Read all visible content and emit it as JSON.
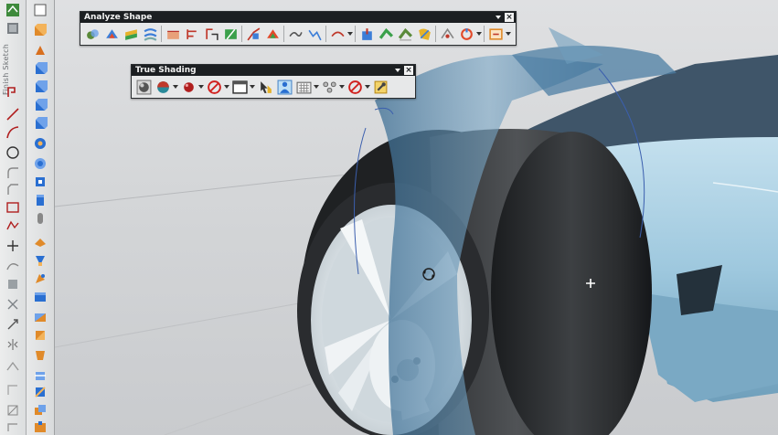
{
  "left_toolbar": {
    "vertical_label": "Finish Sketch",
    "icons": [
      "sketch-select-icon",
      "cube-icon",
      "finish-sketch-icon",
      "profile-icon",
      "line-icon",
      "arc-icon",
      "circle-icon",
      "fillet-icon",
      "chamfer-icon",
      "rectangle-icon",
      "polygon-icon",
      "point-icon",
      "studio-spline-icon",
      "offset-icon",
      "trim-icon",
      "extend-icon",
      "mirror-icon",
      "pattern-icon",
      "constraint-icon",
      "dimension-icon",
      "corner-icon",
      "derived-lines-icon"
    ]
  },
  "right_toolbar": {
    "icons": [
      "select-box-icon",
      "extrude-icon",
      "revolve-icon",
      "block-icon",
      "cylinder-icon",
      "cone-icon",
      "sphere-icon",
      "hole-icon",
      "boss-icon",
      "pocket-icon",
      "pad-icon",
      "slot-icon",
      "groove-icon",
      "thread-icon",
      "rib-icon",
      "edge-blend-icon",
      "chamfer-feature-icon",
      "shell-icon",
      "draft-icon",
      "trim-body-icon",
      "split-body-icon",
      "unite-icon",
      "subtract-icon",
      "intersect-icon"
    ]
  },
  "analyze_shape": {
    "title": "Analyze Shape",
    "buttons": [
      "curve-analysis-icon",
      "face-analysis-icon",
      "radius-analysis-icon",
      "reflection-icon",
      "slope-icon",
      "distance-icon",
      "section-analysis-icon",
      "highlight-lines-icon",
      "face-curvature-icon",
      "deviation-icon",
      "gap-icon",
      "curvature-comb-icon",
      "inflection-icon",
      "draft-analysis-icon",
      "surface-continuity-icon",
      "edge-continuity-icon",
      "shape-icon",
      "sweep-icon",
      "thickness-icon",
      "clearance-icon"
    ]
  },
  "true_shading": {
    "title": "True Shading",
    "buttons": [
      "true-shading-icon",
      "material-sphere-icon",
      "red-sphere-icon",
      "no-entry-icon",
      "background-icon",
      "shading-cursor-icon",
      "person-studio-icon",
      "floor-grid-icon",
      "lights-icon",
      "no-entry-2-icon",
      "settings-icon"
    ]
  },
  "colors": {
    "titlebar": "#1c1f22",
    "toolbar_bg": "#e7e8e9",
    "tire": "#232527",
    "wheel": "#e4e9ec",
    "car_body": "#9fc9df",
    "surface": "#4f82a7",
    "viewport_bg": "#d4d6d8"
  }
}
